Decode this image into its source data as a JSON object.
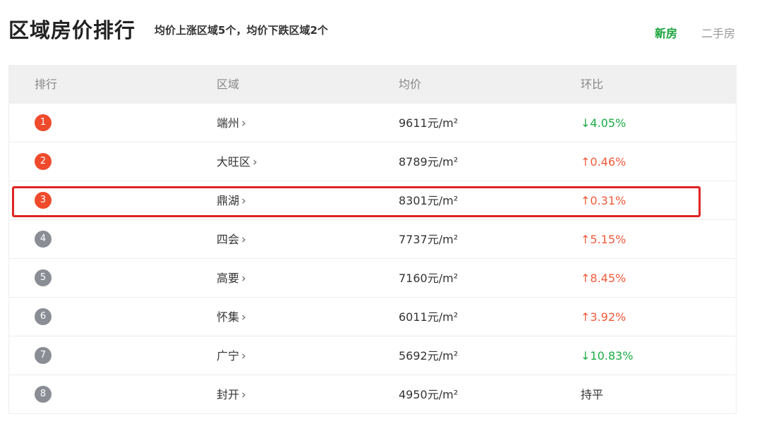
{
  "header": {
    "title": "区域房价排行",
    "summary": "均价上涨区域5个，均价下跌区域2个",
    "tabs": [
      {
        "label": "新房",
        "active": true
      },
      {
        "label": "二手房",
        "active": false
      }
    ]
  },
  "table": {
    "columns": [
      "排行",
      "区域",
      "均价",
      "环比"
    ],
    "rows": [
      {
        "rank": "1",
        "area": "端州",
        "price": "9611元/m²",
        "change": "↓4.05%",
        "trend": "down",
        "highlighted": false
      },
      {
        "rank": "2",
        "area": "大旺区",
        "price": "8789元/m²",
        "change": "↑0.46%",
        "trend": "up",
        "highlighted": false
      },
      {
        "rank": "3",
        "area": "鼎湖",
        "price": "8301元/m²",
        "change": "↑0.31%",
        "trend": "up",
        "highlighted": true
      },
      {
        "rank": "4",
        "area": "四会",
        "price": "7737元/m²",
        "change": "↑5.15%",
        "trend": "up",
        "highlighted": false
      },
      {
        "rank": "5",
        "area": "高要",
        "price": "7160元/m²",
        "change": "↑8.45%",
        "trend": "up",
        "highlighted": false
      },
      {
        "rank": "6",
        "area": "怀集",
        "price": "6011元/m²",
        "change": "↑3.92%",
        "trend": "up",
        "highlighted": false
      },
      {
        "rank": "7",
        "area": "广宁",
        "price": "5692元/m²",
        "change": "↓10.83%",
        "trend": "down",
        "highlighted": false
      },
      {
        "rank": "8",
        "area": "封开",
        "price": "4950元/m²",
        "change": "持平",
        "trend": "flat",
        "highlighted": false
      }
    ]
  },
  "colors": {
    "accent_green": "#18a33b",
    "up_red": "#f05a3a",
    "down_green": "#1aac44",
    "top_badge": "#ef4a2b",
    "normal_badge": "#8a8e94",
    "highlight_border": "#e02424"
  },
  "icons": {
    "area_link_chevron": "chevron-right-icon"
  }
}
